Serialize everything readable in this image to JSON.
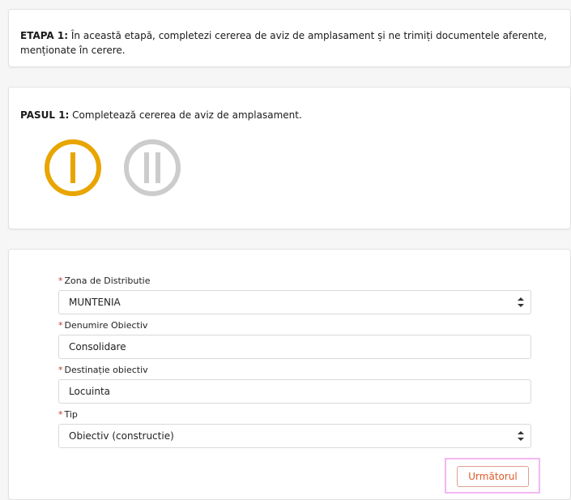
{
  "stage": {
    "prefix": "ETAPA 1:",
    "text": "În această etapă, completezi cererea de aviz de amplasament și ne trimiți documentele aferente, menționate în cerere."
  },
  "step": {
    "prefix": "PASUL 1:",
    "text": "Completează cererea de aviz de amplasament.",
    "indicators": [
      {
        "roman": "I",
        "state": "active",
        "color": "#e8a500"
      },
      {
        "roman": "II",
        "state": "inactive",
        "color": "#cccccc"
      }
    ]
  },
  "form": {
    "required_mark": "*",
    "zona": {
      "label": "Zona de Distributie",
      "value": "MUNTENIA"
    },
    "denumire": {
      "label": "Denumire Obiectiv",
      "value": "Consolidare"
    },
    "destinatie": {
      "label": "Destinație obiectiv",
      "value": "Locuinta"
    },
    "tip": {
      "label": "Tip",
      "value": "Obiectiv (constructie)"
    },
    "next_label": "Următorul"
  },
  "colors": {
    "accent": "#e8a500",
    "required": "#c0392b",
    "button_text": "#e05a2a"
  }
}
